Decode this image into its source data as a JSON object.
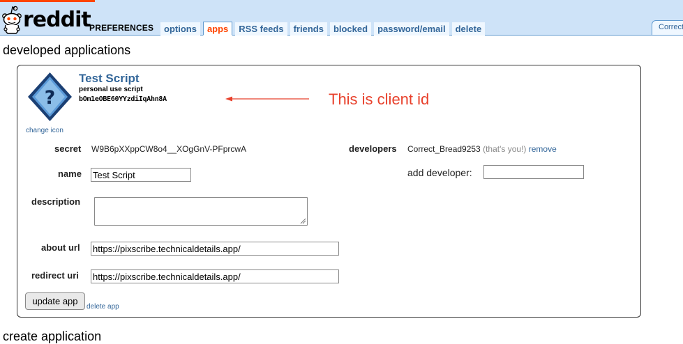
{
  "header": {
    "logo_text": "reddit",
    "page_name": "PREFERENCES",
    "tabs": [
      {
        "label": "options",
        "selected": false
      },
      {
        "label": "apps",
        "selected": true
      },
      {
        "label": "RSS feeds",
        "selected": false
      },
      {
        "label": "friends",
        "selected": false
      },
      {
        "label": "blocked",
        "selected": false
      },
      {
        "label": "password/email",
        "selected": false
      },
      {
        "label": "delete",
        "selected": false
      }
    ],
    "user_box_text": "Correct"
  },
  "section_title": "developed applications",
  "create_title": "create application",
  "app": {
    "name": "Test Script",
    "type": "personal use script",
    "client_id": "bOm1eOBE60YYzdiIqAhn8A",
    "change_icon_label": "change icon",
    "secret_label": "secret",
    "secret_value": "W9B6pXXppCW8o4__XOgGnV-PFprcwA",
    "name_label": "name",
    "name_value": "Test Script",
    "description_label": "description",
    "description_value": "",
    "about_url_label": "about url",
    "about_url_value": "https://pixscribe.technicaldetails.app/",
    "redirect_uri_label": "redirect uri",
    "redirect_uri_value": "https://pixscribe.technicaldetails.app/",
    "developers_label": "developers",
    "developer_name": "Correct_Bread9253",
    "developer_you": "(that's you!)",
    "developer_remove": "remove",
    "add_developer_label": "add developer:",
    "add_developer_value": "",
    "update_button": "update app",
    "delete_link": "delete app"
  },
  "annotation": {
    "text": "This is client id",
    "color": "#e8412c"
  },
  "colors": {
    "header_bg": "#cee3f8",
    "link": "#336699",
    "selected_tab": "#ff4500"
  },
  "icons": {
    "logo": "reddit-alien-icon",
    "app_icon": "question-mark-diamond-icon"
  }
}
